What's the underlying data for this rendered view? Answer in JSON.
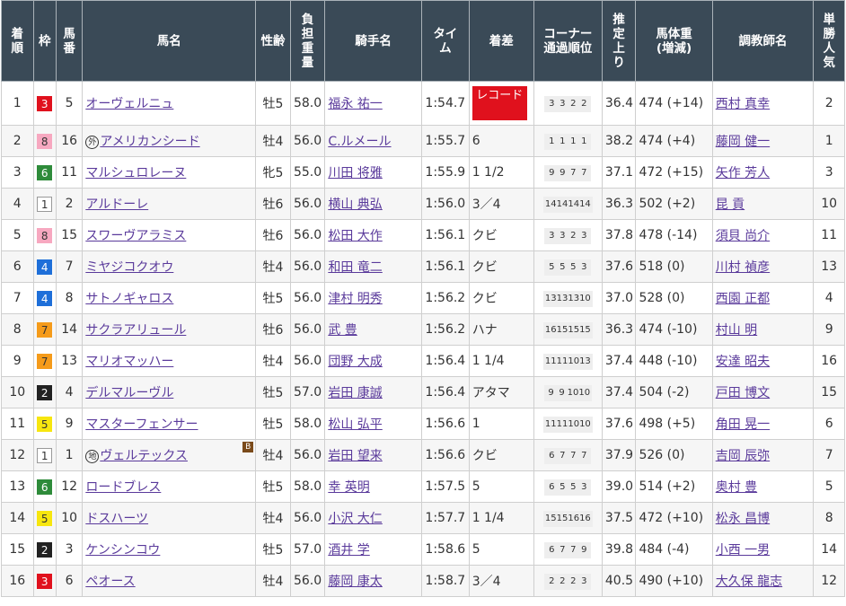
{
  "headers": {
    "rank": "着順",
    "waku": "枠",
    "umaban": "馬番",
    "name": "馬名",
    "sexage": "性齢",
    "weight": "負担重量",
    "jockey": "騎手名",
    "time": "タイム",
    "margin": "着差",
    "corner": "コーナー通過順位",
    "last3f": "推定上り",
    "bodyweight": "馬体重(増減)",
    "trainer": "調教師名",
    "popularity": "単勝人気"
  },
  "header_lines": {
    "rank": [
      "着",
      "順"
    ],
    "weight": [
      "負",
      "担",
      "重",
      "量"
    ],
    "time": [
      "タイ",
      "ム"
    ],
    "corner": [
      "コーナー",
      "通過順位"
    ],
    "last3f": [
      "推",
      "定",
      "上",
      "り"
    ],
    "bodyweight": [
      "馬体重",
      "(増減)"
    ],
    "popularity": [
      "単",
      "勝",
      "人",
      "気"
    ],
    "umaban": [
      "馬",
      "番"
    ]
  },
  "waku_colors": {
    "1": {
      "bg": "#ffffff",
      "fg": "#333333"
    },
    "2": {
      "bg": "#222222",
      "fg": "#ffffff"
    },
    "3": {
      "bg": "#e0111d",
      "fg": "#ffffff"
    },
    "4": {
      "bg": "#1e6fd9",
      "fg": "#ffffff"
    },
    "5": {
      "bg": "#f7e60f",
      "fg": "#333333"
    },
    "6": {
      "bg": "#2e8b3a",
      "fg": "#ffffff"
    },
    "7": {
      "bg": "#f59b1a",
      "fg": "#333333"
    },
    "8": {
      "bg": "#f7a8c0",
      "fg": "#333333"
    }
  },
  "rows": [
    {
      "rank": "1",
      "waku": "3",
      "umaban": "5",
      "mark": "",
      "name": "オーヴェルニュ",
      "blinker": "",
      "sexage": "牡5",
      "weight": "58.0",
      "jockey": "福永 祐一",
      "time": "1:54.7",
      "margin": "",
      "record": "レコード",
      "corner": [
        "3",
        "3",
        "2",
        "2"
      ],
      "last3f": "36.4",
      "bodyweight": "474 (+14)",
      "trainer": "西村 真幸",
      "popularity": "2"
    },
    {
      "rank": "2",
      "waku": "8",
      "umaban": "16",
      "mark": "外",
      "name": "アメリカンシード",
      "blinker": "",
      "sexage": "牡4",
      "weight": "56.0",
      "jockey": "C.ルメール",
      "time": "1:55.7",
      "margin": "6",
      "record": "",
      "corner": [
        "1",
        "1",
        "1",
        "1"
      ],
      "last3f": "38.2",
      "bodyweight": "474 (+4)",
      "trainer": "藤岡 健一",
      "popularity": "1"
    },
    {
      "rank": "3",
      "waku": "6",
      "umaban": "11",
      "mark": "",
      "name": "マルシュロレーヌ",
      "blinker": "",
      "sexage": "牝5",
      "weight": "55.0",
      "jockey": "川田 将雅",
      "time": "1:55.9",
      "margin": "1 1/2",
      "record": "",
      "corner": [
        "9",
        "9",
        "7",
        "7"
      ],
      "last3f": "37.1",
      "bodyweight": "472 (+15)",
      "trainer": "矢作 芳人",
      "popularity": "3"
    },
    {
      "rank": "4",
      "waku": "1",
      "umaban": "2",
      "mark": "",
      "name": "アルドーレ",
      "blinker": "",
      "sexage": "牡6",
      "weight": "56.0",
      "jockey": "横山 典弘",
      "time": "1:56.0",
      "margin": "3／4",
      "record": "",
      "corner": [
        "14",
        "14",
        "14",
        "14"
      ],
      "last3f": "36.3",
      "bodyweight": "502 (+2)",
      "trainer": "昆 貢",
      "popularity": "10"
    },
    {
      "rank": "5",
      "waku": "8",
      "umaban": "15",
      "mark": "",
      "name": "スワーヴアラミス",
      "blinker": "",
      "sexage": "牡6",
      "weight": "56.0",
      "jockey": "松田 大作",
      "time": "1:56.1",
      "margin": "クビ",
      "record": "",
      "corner": [
        "3",
        "3",
        "2",
        "3"
      ],
      "last3f": "37.8",
      "bodyweight": "478 (-14)",
      "trainer": "須貝 尚介",
      "popularity": "11"
    },
    {
      "rank": "6",
      "waku": "4",
      "umaban": "7",
      "mark": "",
      "name": "ミヤジコクオウ",
      "blinker": "",
      "sexage": "牡4",
      "weight": "56.0",
      "jockey": "和田 竜二",
      "time": "1:56.1",
      "margin": "クビ",
      "record": "",
      "corner": [
        "5",
        "5",
        "5",
        "3"
      ],
      "last3f": "37.6",
      "bodyweight": "518 (0)",
      "trainer": "川村 禎彦",
      "popularity": "13"
    },
    {
      "rank": "7",
      "waku": "4",
      "umaban": "8",
      "mark": "",
      "name": "サトノギャロス",
      "blinker": "",
      "sexage": "牡5",
      "weight": "56.0",
      "jockey": "津村 明秀",
      "time": "1:56.2",
      "margin": "クビ",
      "record": "",
      "corner": [
        "13",
        "13",
        "13",
        "10"
      ],
      "last3f": "37.0",
      "bodyweight": "528 (0)",
      "trainer": "西園 正都",
      "popularity": "4"
    },
    {
      "rank": "8",
      "waku": "7",
      "umaban": "14",
      "mark": "",
      "name": "サクラアリュール",
      "blinker": "",
      "sexage": "牡6",
      "weight": "56.0",
      "jockey": "武 豊",
      "time": "1:56.2",
      "margin": "ハナ",
      "record": "",
      "corner": [
        "16",
        "15",
        "15",
        "15"
      ],
      "last3f": "36.3",
      "bodyweight": "474 (-10)",
      "trainer": "村山 明",
      "popularity": "9"
    },
    {
      "rank": "9",
      "waku": "7",
      "umaban": "13",
      "mark": "",
      "name": "マリオマッハー",
      "blinker": "",
      "sexage": "牡4",
      "weight": "56.0",
      "jockey": "団野 大成",
      "time": "1:56.4",
      "margin": "1 1/4",
      "record": "",
      "corner": [
        "11",
        "11",
        "10",
        "13"
      ],
      "last3f": "37.4",
      "bodyweight": "448 (-10)",
      "trainer": "安達 昭夫",
      "popularity": "16"
    },
    {
      "rank": "10",
      "waku": "2",
      "umaban": "4",
      "mark": "",
      "name": "デルマルーヴル",
      "blinker": "",
      "sexage": "牡5",
      "weight": "57.0",
      "jockey": "岩田 康誠",
      "time": "1:56.4",
      "margin": "アタマ",
      "record": "",
      "corner": [
        "9",
        "9",
        "10",
        "10"
      ],
      "last3f": "37.4",
      "bodyweight": "504 (-2)",
      "trainer": "戸田 博文",
      "popularity": "15"
    },
    {
      "rank": "11",
      "waku": "5",
      "umaban": "9",
      "mark": "",
      "name": "マスターフェンサー",
      "blinker": "",
      "sexage": "牡5",
      "weight": "58.0",
      "jockey": "松山 弘平",
      "time": "1:56.6",
      "margin": "1",
      "record": "",
      "corner": [
        "11",
        "11",
        "10",
        "10"
      ],
      "last3f": "37.6",
      "bodyweight": "498 (+5)",
      "trainer": "角田 晃一",
      "popularity": "6"
    },
    {
      "rank": "12",
      "waku": "1",
      "umaban": "1",
      "mark": "地",
      "name": "ヴェルテックス",
      "blinker": "B",
      "sexage": "牡4",
      "weight": "56.0",
      "jockey": "岩田 望来",
      "time": "1:56.6",
      "margin": "クビ",
      "record": "",
      "corner": [
        "6",
        "7",
        "7",
        "7"
      ],
      "last3f": "37.9",
      "bodyweight": "526 (0)",
      "trainer": "吉岡 辰弥",
      "popularity": "7"
    },
    {
      "rank": "13",
      "waku": "6",
      "umaban": "12",
      "mark": "",
      "name": "ロードブレス",
      "blinker": "",
      "sexage": "牡5",
      "weight": "58.0",
      "jockey": "幸 英明",
      "time": "1:57.5",
      "margin": "5",
      "record": "",
      "corner": [
        "6",
        "5",
        "5",
        "3"
      ],
      "last3f": "39.0",
      "bodyweight": "514 (+2)",
      "trainer": "奥村 豊",
      "popularity": "5"
    },
    {
      "rank": "14",
      "waku": "5",
      "umaban": "10",
      "mark": "",
      "name": "ドスハーツ",
      "blinker": "",
      "sexage": "牡4",
      "weight": "56.0",
      "jockey": "小沢 大仁",
      "time": "1:57.7",
      "margin": "1 1/4",
      "record": "",
      "corner": [
        "15",
        "15",
        "16",
        "16"
      ],
      "last3f": "37.5",
      "bodyweight": "472 (+10)",
      "trainer": "松永 昌博",
      "popularity": "8"
    },
    {
      "rank": "15",
      "waku": "2",
      "umaban": "3",
      "mark": "",
      "name": "ケンシンコウ",
      "blinker": "",
      "sexage": "牡5",
      "weight": "57.0",
      "jockey": "酒井 学",
      "time": "1:58.6",
      "margin": "5",
      "record": "",
      "corner": [
        "6",
        "7",
        "7",
        "9"
      ],
      "last3f": "39.8",
      "bodyweight": "484 (-4)",
      "trainer": "小西 一男",
      "popularity": "14"
    },
    {
      "rank": "16",
      "waku": "3",
      "umaban": "6",
      "mark": "",
      "name": "ペオース",
      "blinker": "",
      "sexage": "牡4",
      "weight": "56.0",
      "jockey": "藤岡 康太",
      "time": "1:58.7",
      "margin": "3／4",
      "record": "",
      "corner": [
        "2",
        "2",
        "2",
        "3"
      ],
      "last3f": "40.5",
      "bodyweight": "490 (+10)",
      "trainer": "大久保 龍志",
      "popularity": "12"
    }
  ]
}
